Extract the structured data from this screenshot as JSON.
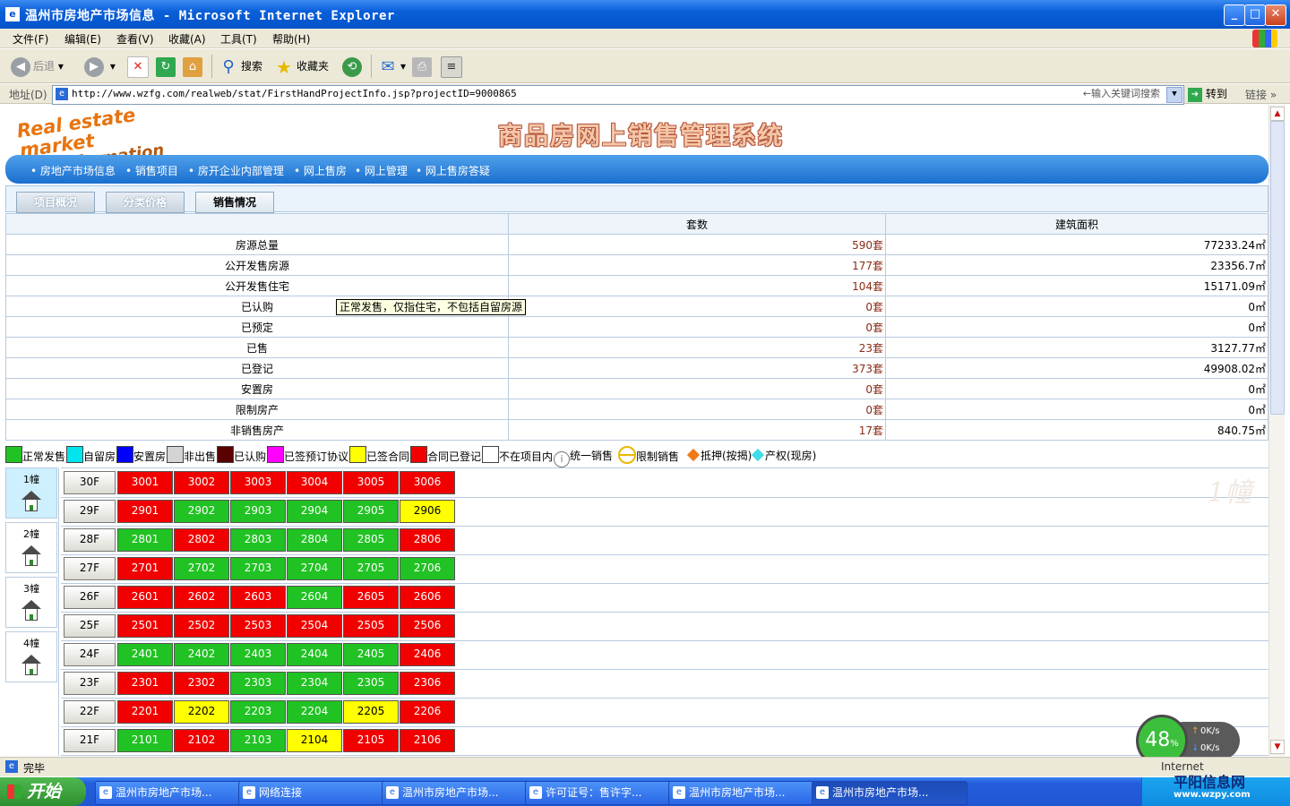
{
  "window": {
    "title": "温州市房地产市场信息 - Microsoft Internet Explorer"
  },
  "menu": [
    "文件(F)",
    "编辑(E)",
    "查看(V)",
    "收藏(A)",
    "工具(T)",
    "帮助(H)"
  ],
  "toolbar": {
    "back": "后退",
    "search": "搜索",
    "favorites": "收藏夹"
  },
  "address": {
    "label": "地址(D)",
    "url": "http://www.wzfg.com/realweb/stat/FirstHandProjectInfo.jsp?projectID=9000865",
    "search_placeholder": "←输入关键词搜索",
    "go": "转到",
    "links": "链接"
  },
  "brand": {
    "line1": "Real estate market",
    "line2": "Information"
  },
  "system_title": "商品房网上销售管理系统",
  "nav": [
    "房地产市场信息",
    "销售项目",
    "房开企业内部管理",
    "网上售房",
    "网上管理",
    "网上售房答疑"
  ],
  "tabs": [
    "项目概况",
    "分类价格",
    "销售情况"
  ],
  "stats": {
    "headers": [
      "",
      "套数",
      "建筑面积"
    ],
    "rows": [
      {
        "label": "房源总量",
        "count": "590套",
        "area": "77233.24㎡"
      },
      {
        "label": "公开发售房源",
        "count": "177套",
        "area": "23356.7㎡"
      },
      {
        "label": "公开发售住宅",
        "count": "104套",
        "area": "15171.09㎡"
      },
      {
        "label": "已认购",
        "count": "0套",
        "area": "0㎡"
      },
      {
        "label": "已预定",
        "count": "0套",
        "area": "0㎡"
      },
      {
        "label": "已售",
        "count": "23套",
        "area": "3127.77㎡"
      },
      {
        "label": "已登记",
        "count": "373套",
        "area": "49908.02㎡"
      },
      {
        "label": "安置房",
        "count": "0套",
        "area": "0㎡"
      },
      {
        "label": "限制房产",
        "count": "0套",
        "area": "0㎡"
      },
      {
        "label": "非销售房产",
        "count": "17套",
        "area": "840.75㎡"
      }
    ]
  },
  "tooltip": "正常发售，仅指住宅，不包括自留房源",
  "legend": [
    {
      "label": "正常发售",
      "color": "#21c223"
    },
    {
      "label": "自留房",
      "color": "#00e5ee"
    },
    {
      "label": "安置房",
      "color": "#0000ff"
    },
    {
      "label": "非出售",
      "color": "#d4d4d4"
    },
    {
      "label": "已认购",
      "color": "#5a0000"
    },
    {
      "label": "已签预订协议",
      "color": "#ff00ff"
    },
    {
      "label": "已签合同",
      "color": "#ffff00"
    },
    {
      "label": "合同已登记",
      "color": "#f20000"
    },
    {
      "label": "不在项目内",
      "color": "#ffffff"
    },
    {
      "label": "统一销售",
      "icon": "info-circle-icon"
    },
    {
      "label": "限制销售",
      "icon": "no-entry-icon"
    },
    {
      "label": "抵押(按揭)",
      "icon": "diamond-orange-icon"
    },
    {
      "label": "产权(现房)",
      "icon": "diamond-cyan-icon"
    }
  ],
  "buildings": [
    "1幢",
    "2幢",
    "3幢",
    "4幢"
  ],
  "building_watermark": "1幢",
  "floors": [
    {
      "floor": "30F",
      "units": [
        [
          "3001",
          "red"
        ],
        [
          "3002",
          "red"
        ],
        [
          "3003",
          "red"
        ],
        [
          "3004",
          "red"
        ],
        [
          "3005",
          "red"
        ],
        [
          "3006",
          "red"
        ]
      ]
    },
    {
      "floor": "29F",
      "units": [
        [
          "2901",
          "red"
        ],
        [
          "2902",
          "green"
        ],
        [
          "2903",
          "green"
        ],
        [
          "2904",
          "green"
        ],
        [
          "2905",
          "green"
        ],
        [
          "2906",
          "yellow"
        ]
      ]
    },
    {
      "floor": "28F",
      "units": [
        [
          "2801",
          "green"
        ],
        [
          "2802",
          "red"
        ],
        [
          "2803",
          "green"
        ],
        [
          "2804",
          "green"
        ],
        [
          "2805",
          "green"
        ],
        [
          "2806",
          "red"
        ]
      ]
    },
    {
      "floor": "27F",
      "units": [
        [
          "2701",
          "red"
        ],
        [
          "2702",
          "green"
        ],
        [
          "2703",
          "green"
        ],
        [
          "2704",
          "green"
        ],
        [
          "2705",
          "green"
        ],
        [
          "2706",
          "green"
        ]
      ]
    },
    {
      "floor": "26F",
      "units": [
        [
          "2601",
          "red"
        ],
        [
          "2602",
          "red"
        ],
        [
          "2603",
          "red"
        ],
        [
          "2604",
          "green"
        ],
        [
          "2605",
          "red"
        ],
        [
          "2606",
          "red"
        ]
      ]
    },
    {
      "floor": "25F",
      "units": [
        [
          "2501",
          "red"
        ],
        [
          "2502",
          "red"
        ],
        [
          "2503",
          "red"
        ],
        [
          "2504",
          "red"
        ],
        [
          "2505",
          "red"
        ],
        [
          "2506",
          "red"
        ]
      ]
    },
    {
      "floor": "24F",
      "units": [
        [
          "2401",
          "green"
        ],
        [
          "2402",
          "green"
        ],
        [
          "2403",
          "green"
        ],
        [
          "2404",
          "green"
        ],
        [
          "2405",
          "green"
        ],
        [
          "2406",
          "red"
        ]
      ]
    },
    {
      "floor": "23F",
      "units": [
        [
          "2301",
          "red"
        ],
        [
          "2302",
          "red"
        ],
        [
          "2303",
          "green"
        ],
        [
          "2304",
          "green"
        ],
        [
          "2305",
          "green"
        ],
        [
          "2306",
          "red"
        ]
      ]
    },
    {
      "floor": "22F",
      "units": [
        [
          "2201",
          "red"
        ],
        [
          "2202",
          "yellow"
        ],
        [
          "2203",
          "green"
        ],
        [
          "2204",
          "green"
        ],
        [
          "2205",
          "yellow"
        ],
        [
          "2206",
          "red"
        ]
      ]
    },
    {
      "floor": "21F",
      "units": [
        [
          "2101",
          "green"
        ],
        [
          "2102",
          "red"
        ],
        [
          "2103",
          "green"
        ],
        [
          "2104",
          "yellow"
        ],
        [
          "2105",
          "red"
        ],
        [
          "2106",
          "red"
        ]
      ]
    }
  ],
  "status": {
    "text": "完毕",
    "zone": "Internet"
  },
  "taskbar": {
    "start": "开始",
    "tasks": [
      "温州市房地产市场...",
      "网络连接",
      "温州市房地产市场...",
      "许可证号：售许字...",
      "温州市房地产市场...",
      "温州市房地产市场..."
    ]
  },
  "speed": {
    "percent": "48",
    "unit": "%",
    "up": "0K/s",
    "down": "0K/s"
  },
  "watermark": {
    "name": "平阳信息网",
    "url": "www.wzpy.com"
  }
}
